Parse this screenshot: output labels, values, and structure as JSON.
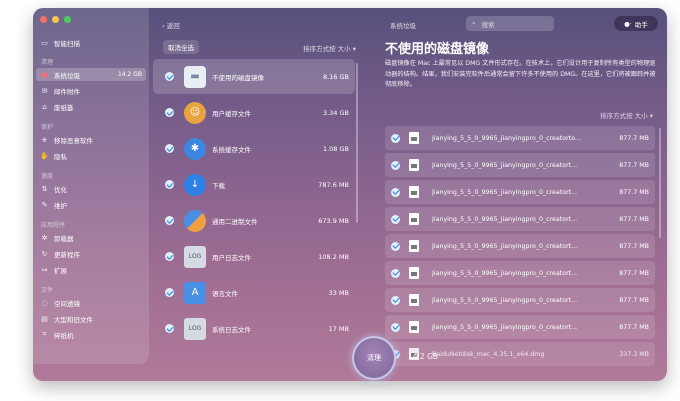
{
  "colors": {
    "close": "#f25b55",
    "minimize": "#f6bd2f",
    "zoom": "#30c646",
    "check": "#2f7fe0"
  },
  "header": {
    "back_label": "返回",
    "section_title": "系统垃圾",
    "search_placeholder": "搜索",
    "help_label": "助手"
  },
  "sidebar": {
    "top": {
      "label": "智能扫描",
      "icon": "monitor-icon"
    },
    "groups": [
      {
        "title": "清理",
        "items": [
          {
            "label": "系统垃圾",
            "icon": "trash-icon",
            "size": "14.2 GB",
            "active": true
          },
          {
            "label": "邮件附件",
            "icon": "mail-icon"
          },
          {
            "label": "废纸篓",
            "icon": "bin-icon"
          }
        ]
      },
      {
        "title": "保护",
        "items": [
          {
            "label": "移除恶意软件",
            "icon": "biohazard-icon"
          },
          {
            "label": "隐私",
            "icon": "hand-icon"
          }
        ]
      },
      {
        "title": "速度",
        "items": [
          {
            "label": "优化",
            "icon": "sliders-icon"
          },
          {
            "label": "维护",
            "icon": "wrench-icon"
          }
        ]
      },
      {
        "title": "应用程序",
        "items": [
          {
            "label": "卸载器",
            "icon": "uninstaller-icon"
          },
          {
            "label": "更新程序",
            "icon": "update-icon"
          },
          {
            "label": "扩展",
            "icon": "extension-icon"
          }
        ]
      },
      {
        "title": "文件",
        "items": [
          {
            "label": "空间透镜",
            "icon": "lens-icon"
          },
          {
            "label": "大型和旧文件",
            "icon": "folder-icon"
          },
          {
            "label": "碎纸机",
            "icon": "shredder-icon"
          }
        ]
      }
    ]
  },
  "middle": {
    "deselect_all": "取消全选",
    "sort_label": "排序方式按 大小 ▾",
    "categories": [
      {
        "label": "不使用的磁盘镜像",
        "size": "8.16 GB",
        "icon": "disk-image-icon",
        "color": "#e9eef4",
        "selected": true
      },
      {
        "label": "用户缓存文件",
        "size": "3.34 GB",
        "icon": "user-cache-icon",
        "color": "#e8a341"
      },
      {
        "label": "系统缓存文件",
        "size": "1.08 GB",
        "icon": "system-cache-icon",
        "color": "#3a86e0"
      },
      {
        "label": "下载",
        "size": "787.6 MB",
        "icon": "download-icon",
        "color": "#2f80e8"
      },
      {
        "label": "通用二进制文件",
        "size": "673.9 MB",
        "icon": "binary-icon",
        "color": "#f0a040"
      },
      {
        "label": "用户日志文件",
        "size": "108.2 MB",
        "icon": "user-log-icon",
        "color": "#d5dbe3"
      },
      {
        "label": "语言文件",
        "size": "33 MB",
        "icon": "language-icon",
        "color": "#4a8fe6"
      },
      {
        "label": "系统日志文件",
        "size": "17 MB",
        "icon": "system-log-icon",
        "color": "#d5dbe3"
      }
    ]
  },
  "detail": {
    "title": "不使用的磁盘镜像",
    "description": "磁盘镜像在 Mac 上最常见以 DMG 文件形式存在。在技术上，它们设计用于复制所有类型的物理驱动器的结构。结果，我们安装完软件后通常会留下许多不使用的 DMG。在这里，它们将被跟踪并被彻底移除。",
    "sort_label": "排序方式按 大小 ▾",
    "files": [
      {
        "name": "Jianying_5_5_0_9965_jianyingpro_0_creatorto...",
        "size": "877.7 MB"
      },
      {
        "name": "Jianying_5_5_0_9965_jianyingpro_0_creatort...",
        "size": "877.7 MB"
      },
      {
        "name": "Jianying_5_5_0_9965_jianyingpro_0_creatort...",
        "size": "877.7 MB"
      },
      {
        "name": "Jianying_5_5_0_9965_jianyingpro_0_creatort...",
        "size": "877.7 MB"
      },
      {
        "name": "Jianying_5_5_0_9965_jianyingpro_0_creatort...",
        "size": "877.7 MB"
      },
      {
        "name": "Jianying_5_5_0_9965_jianyingpro_0_creatort...",
        "size": "877.7 MB"
      },
      {
        "name": "Jianying_5_5_0_9965_jianyingpro_0_creatort...",
        "size": "877.7 MB"
      },
      {
        "name": "Jianying_5_5_0_9965_jianyingpro_0_creatort...",
        "size": "877.7 MB"
      },
      {
        "name": "BaiduNetdisk_mac_4.35.1_x64.dmg",
        "size": "337.3 MB"
      }
    ]
  },
  "footer": {
    "clean_label": "清理",
    "total_size": "14.2 GB"
  }
}
